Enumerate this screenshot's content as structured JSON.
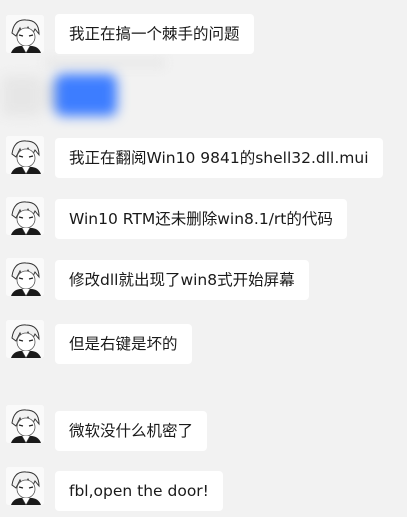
{
  "messages": [
    {
      "text": "我正在搞一个棘手的问题"
    },
    {
      "text": "我正在翻阅Win10 9841的shell32.dll.mui"
    },
    {
      "text": "Win10 RTM还未删除win8.1/rt的代码"
    },
    {
      "text": "修改dll就出现了win8式开始屏幕"
    },
    {
      "text": "但是右键是坏的"
    },
    {
      "text": "微软没什么机密了"
    },
    {
      "text": "fbl,open the door!"
    }
  ],
  "colors": {
    "background": "#f2f2f2",
    "bubble": "#ffffff",
    "blurred_accent": "#3d7dff"
  },
  "icons": {
    "avatar": "anime-avatar-icon"
  }
}
